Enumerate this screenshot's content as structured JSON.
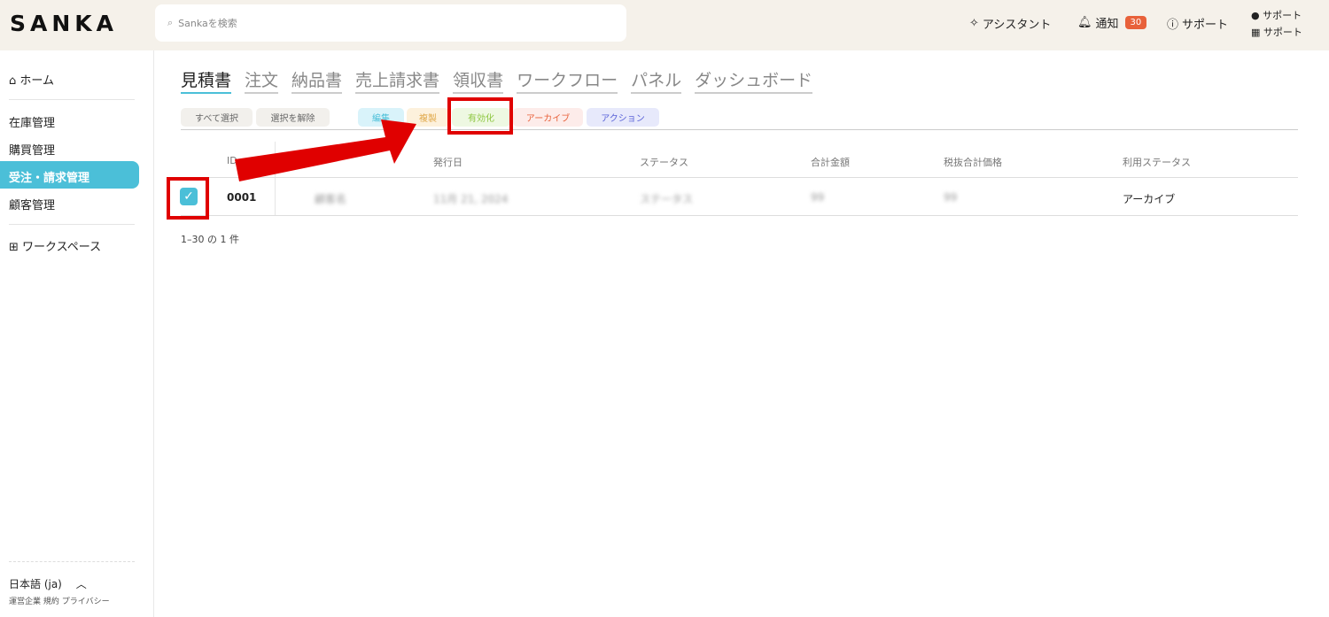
{
  "header": {
    "logo": "SANKA",
    "search_placeholder": "Sankaを検索",
    "assistant": "アシスタント",
    "notifications": "通知",
    "notification_count": "30",
    "support": "サポート",
    "user_line1": "サポート",
    "user_line2": "サポート"
  },
  "sidebar": {
    "home": "ホーム",
    "items": [
      "在庫管理",
      "購買管理",
      "受注・請求管理",
      "顧客管理"
    ],
    "workspace": "ワークスペース",
    "language": "日本語 (ja)",
    "footer_links": [
      "運営企業",
      "規約",
      "プライバシー"
    ]
  },
  "tabs": [
    "見積書",
    "注文",
    "納品書",
    "売上請求書",
    "領収書",
    "ワークフロー",
    "パネル",
    "ダッシュボード"
  ],
  "toolbar": {
    "select_all": "すべて選択",
    "deselect": "選択を解除",
    "edit": "編集",
    "duplicate": "複製",
    "activate": "有効化",
    "archive": "アーカイブ",
    "action": "アクション"
  },
  "table": {
    "headers": [
      "ID",
      "",
      "発行日",
      "ステータス",
      "合計金額",
      "税抜合計価格",
      "利用ステータス"
    ],
    "rows": [
      {
        "id": "0001",
        "customer": "顧客名",
        "date": "11月 21, 2024",
        "status": "ステータス",
        "total": "99",
        "subtotal": "99",
        "usage": "アーカイブ"
      }
    ]
  },
  "pagination": "1–30 の 1 件",
  "colors": {
    "accent": "#4bbfd8",
    "highlight": "#e00000"
  }
}
